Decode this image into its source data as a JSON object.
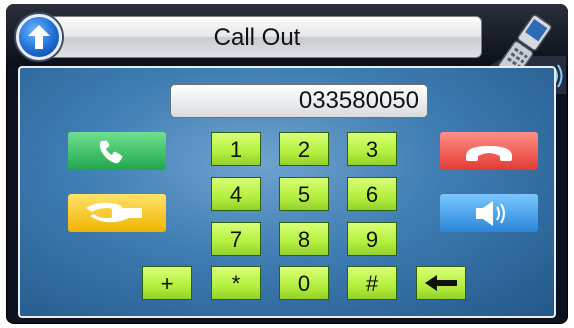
{
  "header": {
    "title": "Call Out",
    "back_icon": "up-arrow-icon",
    "phone_icon": "flip-phone-icon",
    "phone_status_icon": "sound-waves-icon"
  },
  "display": {
    "number": "033580050"
  },
  "keypad": {
    "row1": [
      "1",
      "2",
      "3"
    ],
    "row2": [
      "4",
      "5",
      "6"
    ],
    "row3": [
      "7",
      "8",
      "9"
    ],
    "row4": [
      "*",
      "0",
      "#"
    ],
    "plus": "+"
  },
  "actions": {
    "call_icon": "phone-handset-icon",
    "transfer_icon": "call-transfer-icon",
    "hangup_icon": "hang-up-icon",
    "speaker_icon": "speaker-icon",
    "backspace_icon": "backspace-arrow-icon"
  },
  "colors": {
    "key_green": "#b3ef3d",
    "call_green": "#20a64c",
    "transfer_yellow": "#f0b400",
    "hangup_red": "#e13b34",
    "speaker_blue": "#2c86d8"
  }
}
